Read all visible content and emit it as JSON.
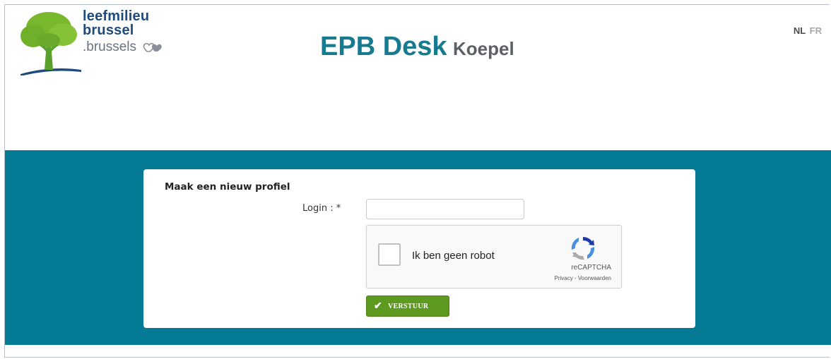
{
  "logo": {
    "line1": "leefmilieu",
    "line2": "brussel",
    "line3": ".brussels"
  },
  "header": {
    "title": "EPB Desk",
    "subtitle": "Koepel"
  },
  "language": {
    "active": "NL",
    "other": "FR"
  },
  "form": {
    "title": "Maak een nieuw profiel",
    "login_label": "Login : *",
    "login_value": "",
    "captcha": {
      "label": "Ik ben geen robot",
      "brand": "reCAPTCHA",
      "links": "Privacy - Voorwaarden"
    },
    "submit_label": "VERSTUUR"
  },
  "colors": {
    "band": "#047a95",
    "title": "#177b90",
    "submit": "#5e9a1f"
  }
}
